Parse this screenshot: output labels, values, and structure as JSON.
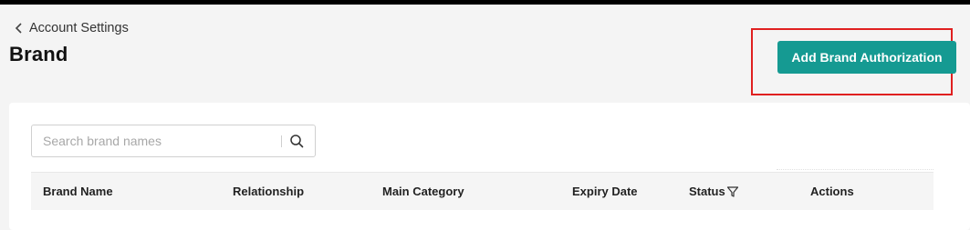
{
  "header": {
    "back_label": "Account Settings",
    "page_title": "Brand",
    "add_button_label": "Add Brand Authorization"
  },
  "search": {
    "placeholder": "Search brand names"
  },
  "table": {
    "columns": [
      "Brand Name",
      "Relationship",
      "Main Category",
      "Expiry Date",
      "Status",
      "Actions"
    ]
  },
  "icons": {
    "back": "chevron-left-icon",
    "search": "search-icon",
    "status_filter": "filter-icon"
  },
  "colors": {
    "accent": "#159a92",
    "highlight_box": "#e02020"
  }
}
